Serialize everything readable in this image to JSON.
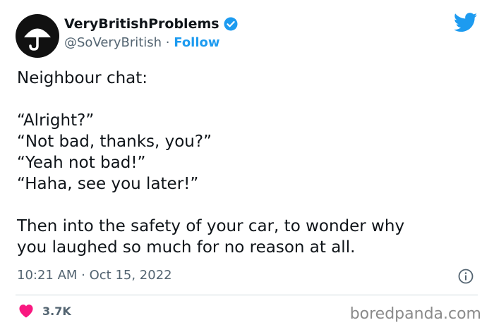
{
  "author": {
    "display_name": "VeryBritishProblems",
    "handle": "@SoVeryBritish",
    "separator": " · ",
    "follow_label": "Follow"
  },
  "tweet": {
    "text": "Neighbour chat:\n\n“Alright?”\n“Not bad, thanks, you?”\n“Yeah not bad!”\n“Haha, see you later!”\n\nThen into the safety of your car, to wonder why\nyou laughed so much for no reason at all.",
    "timestamp": "10:21 AM · Oct 15, 2022",
    "like_count": "3.7K"
  },
  "watermark": "boredpanda.com",
  "colors": {
    "accent": "#1d9bf0",
    "heart": "#f91880",
    "secondary_text": "#536471"
  },
  "icons": [
    "umbrella-avatar-icon",
    "verified-badge-icon",
    "twitter-bird-icon",
    "info-icon",
    "heart-icon"
  ]
}
